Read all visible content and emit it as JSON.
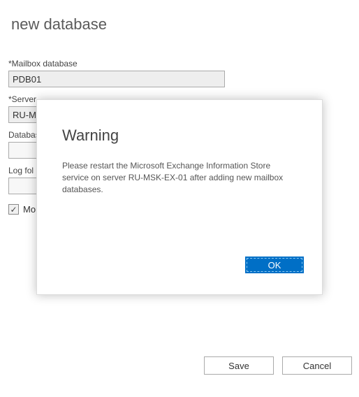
{
  "page": {
    "title": "new database"
  },
  "fields": {
    "mailbox_label": "*Mailbox database",
    "mailbox_value": "PDB01",
    "server_label": "*Server",
    "server_value": "RU-MS",
    "db_path_label": "Databas",
    "db_path_value": "",
    "log_path_label": "Log fol",
    "log_path_value": "",
    "mount_label": "Mo"
  },
  "dialog": {
    "title": "Warning",
    "message": "Please restart the Microsoft Exchange Information Store service on server RU-MSK-EX-01 after adding new mailbox databases.",
    "ok_label": "OK"
  },
  "buttons": {
    "save": "Save",
    "cancel": "Cancel"
  }
}
